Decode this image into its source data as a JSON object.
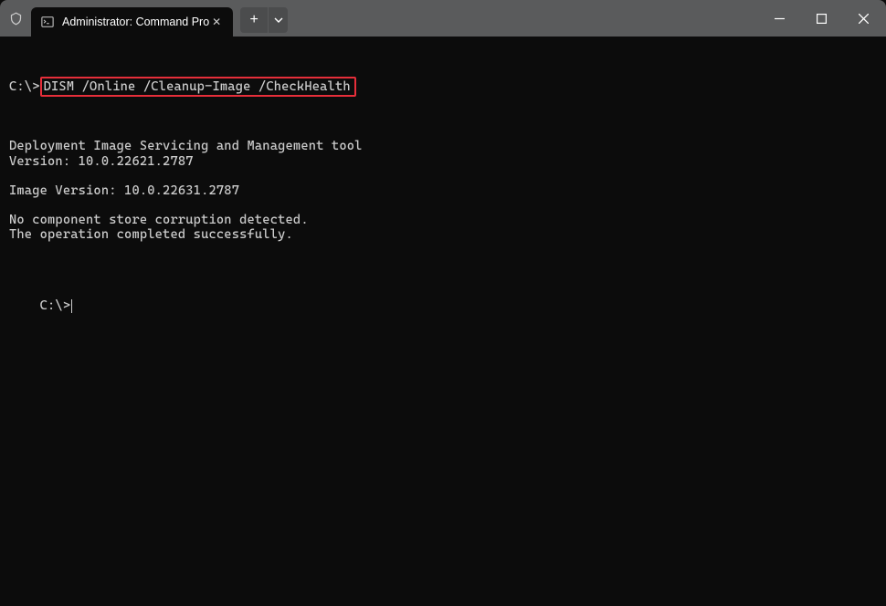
{
  "window": {
    "tab_title": "Administrator: Command Pro"
  },
  "terminal": {
    "prompt1": "C:\\>",
    "command": "DISM /Online /Cleanup-Image /CheckHealth",
    "output_lines": [
      "Deployment Image Servicing and Management tool",
      "Version: 10.0.22621.2787",
      "",
      "Image Version: 10.0.22631.2787",
      "",
      "No component store corruption detected.",
      "The operation completed successfully."
    ],
    "prompt2": "C:\\>"
  }
}
